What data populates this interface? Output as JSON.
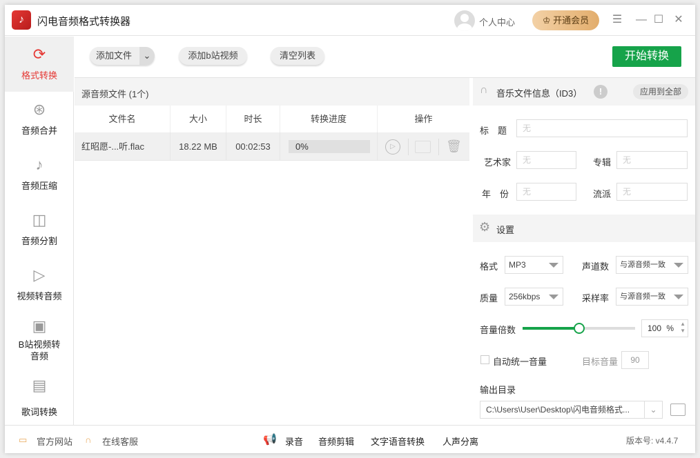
{
  "app": {
    "title": "闪电音频格式转换器",
    "user": "个人中心",
    "vip": "开通会员"
  },
  "sidebar": {
    "items": [
      {
        "label": "格式转换"
      },
      {
        "label": "音频合并"
      },
      {
        "label": "音频压缩"
      },
      {
        "label": "音频分割"
      },
      {
        "label": "视频转音频"
      },
      {
        "label": "B站视频转音频"
      },
      {
        "label": "歌词转换"
      }
    ]
  },
  "toolbar": {
    "add_file": "添加文件",
    "add_bili": "添加b站视频",
    "clear": "清空列表",
    "start": "开始转换"
  },
  "list": {
    "title": "源音频文件 (1个)",
    "columns": [
      "文件名",
      "大小",
      "时长",
      "转换进度",
      "操作"
    ],
    "rows": [
      {
        "name": "红昭愿-...听.flac",
        "size": "18.22 MB",
        "duration": "00:02:53",
        "progress": "0%"
      }
    ]
  },
  "id3": {
    "title": "音乐文件信息（ID3）",
    "apply_all": "应用到全部",
    "title_label": "标　题",
    "artist_label": "艺术家",
    "album_label": "专辑",
    "year_label": "年　份",
    "genre_label": "流派",
    "placeholder": "无"
  },
  "settings": {
    "title": "设置",
    "format_label": "格式",
    "format": "MP3",
    "channels_label": "声道数",
    "channels": "与源音频一致",
    "quality_label": "质量",
    "quality": "256kbps",
    "samplerate_label": "采样率",
    "samplerate": "与源音频一致",
    "volume_label": "音量倍数",
    "volume": "100",
    "volume_unit": "%",
    "volume_fraction": 0.5,
    "auto_label": "自动统一音量",
    "target_label": "目标音量",
    "target": "90",
    "output_label": "输出目录",
    "output_path": "C:\\Users\\User\\Desktop\\闪电音频格式..."
  },
  "footer": {
    "website": "官方网站",
    "service": "在线客服",
    "links": [
      "录音",
      "音频剪辑",
      "文字语音转换",
      "人声分离"
    ],
    "version": "版本号: v4.4.7"
  },
  "colors": {
    "accent": "#16a34a",
    "active": "#e53935"
  }
}
